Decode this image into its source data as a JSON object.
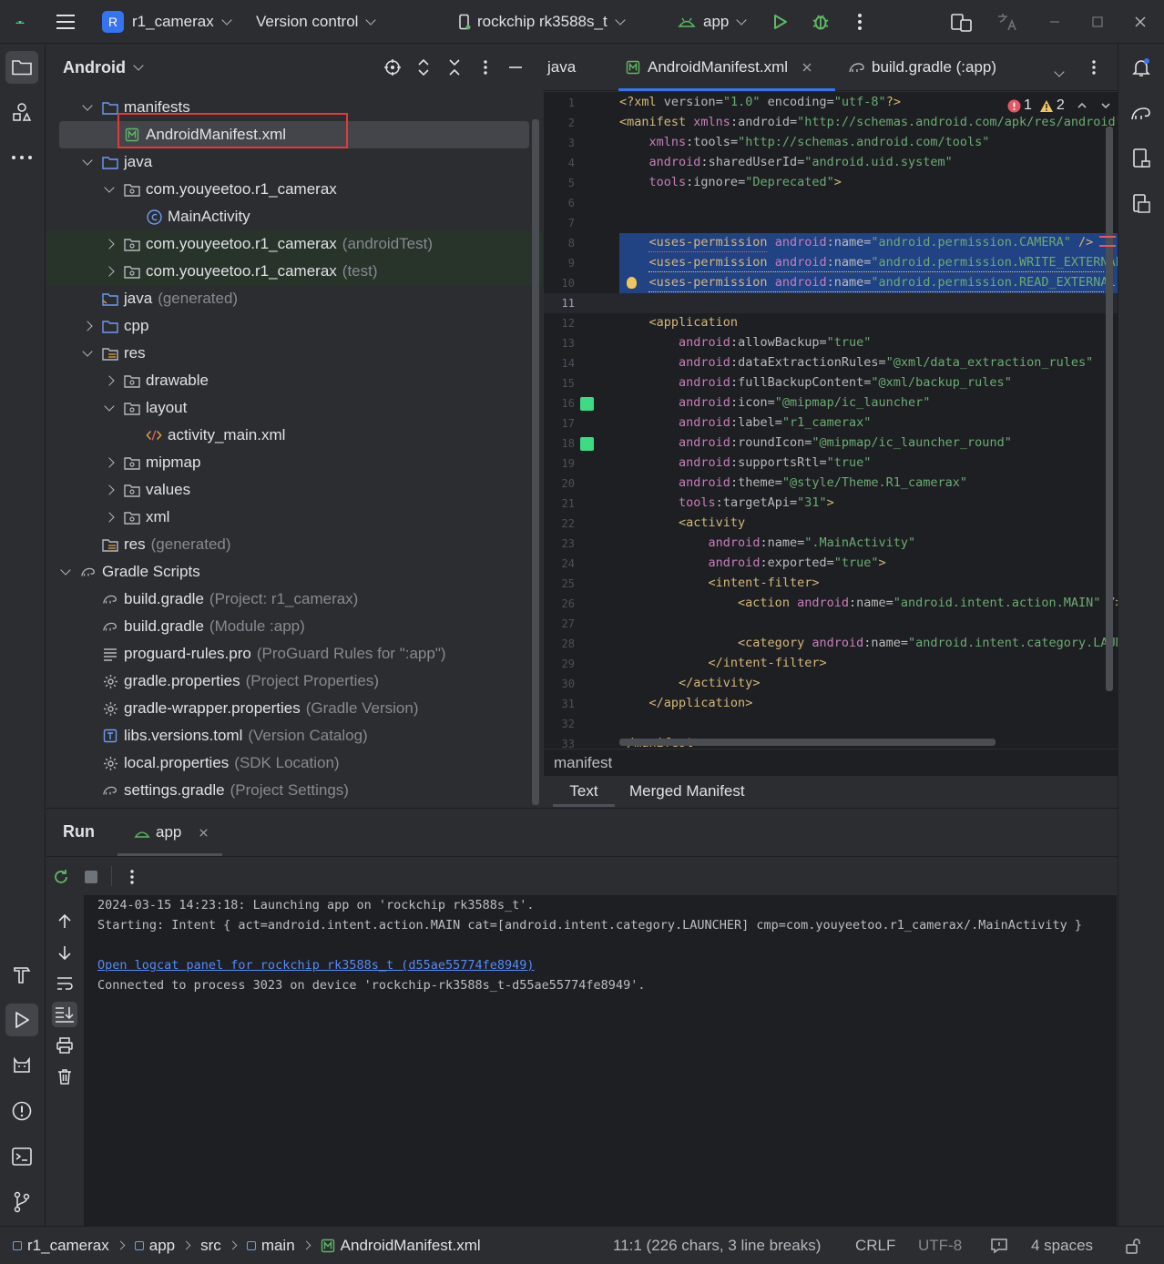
{
  "titlebar": {
    "project_badge": "R",
    "project_name": "r1_camerax",
    "vcs": "Version control",
    "device": "rockchip rk3588s_t",
    "run_config": "app"
  },
  "project_panel": {
    "view_name": "Android",
    "tree": [
      {
        "label": "manifests",
        "suffix": "",
        "depth": 2,
        "arrow": "down",
        "icon": "folder"
      },
      {
        "label": "AndroidManifest.xml",
        "suffix": "",
        "depth": 3,
        "arrow": "",
        "icon": "manifest",
        "selected": true
      },
      {
        "label": "java",
        "suffix": "",
        "depth": 2,
        "arrow": "down",
        "icon": "folder"
      },
      {
        "label": "com.youyeetoo.r1_camerax",
        "suffix": "",
        "depth": 3,
        "arrow": "down",
        "icon": "package"
      },
      {
        "label": "MainActivity",
        "suffix": "",
        "depth": 4,
        "arrow": "",
        "icon": "class"
      },
      {
        "label": "com.youyeetoo.r1_camerax",
        "suffix": "(androidTest)",
        "depth": 3,
        "arrow": "right",
        "icon": "package",
        "test": true
      },
      {
        "label": "com.youyeetoo.r1_camerax",
        "suffix": "(test)",
        "depth": 3,
        "arrow": "right",
        "icon": "package",
        "test": true
      },
      {
        "label": "java",
        "suffix": "(generated)",
        "depth": 2,
        "arrow": "",
        "icon": "folder-gen"
      },
      {
        "label": "cpp",
        "suffix": "",
        "depth": 2,
        "arrow": "right",
        "icon": "folder"
      },
      {
        "label": "res",
        "suffix": "",
        "depth": 2,
        "arrow": "down",
        "icon": "res"
      },
      {
        "label": "drawable",
        "suffix": "",
        "depth": 3,
        "arrow": "right",
        "icon": "package"
      },
      {
        "label": "layout",
        "suffix": "",
        "depth": 3,
        "arrow": "down",
        "icon": "package"
      },
      {
        "label": "activity_main.xml",
        "suffix": "",
        "depth": 4,
        "arrow": "",
        "icon": "xml"
      },
      {
        "label": "mipmap",
        "suffix": "",
        "depth": 3,
        "arrow": "right",
        "icon": "package"
      },
      {
        "label": "values",
        "suffix": "",
        "depth": 3,
        "arrow": "right",
        "icon": "package"
      },
      {
        "label": "xml",
        "suffix": "",
        "depth": 3,
        "arrow": "right",
        "icon": "package"
      },
      {
        "label": "res",
        "suffix": "(generated)",
        "depth": 2,
        "arrow": "",
        "icon": "res"
      },
      {
        "label": "Gradle Scripts",
        "suffix": "",
        "depth": 1,
        "arrow": "down",
        "icon": "gradle"
      },
      {
        "label": "build.gradle",
        "suffix": "(Project: r1_camerax)",
        "depth": 2,
        "arrow": "",
        "icon": "gradle"
      },
      {
        "label": "build.gradle",
        "suffix": "(Module :app)",
        "depth": 2,
        "arrow": "",
        "icon": "gradle"
      },
      {
        "label": "proguard-rules.pro",
        "suffix": "(ProGuard Rules for \":app\")",
        "depth": 2,
        "arrow": "",
        "icon": "lines"
      },
      {
        "label": "gradle.properties",
        "suffix": "(Project Properties)",
        "depth": 2,
        "arrow": "",
        "icon": "gear"
      },
      {
        "label": "gradle-wrapper.properties",
        "suffix": "(Gradle Version)",
        "depth": 2,
        "arrow": "",
        "icon": "gear"
      },
      {
        "label": "libs.versions.toml",
        "suffix": "(Version Catalog)",
        "depth": 2,
        "arrow": "",
        "icon": "toml"
      },
      {
        "label": "local.properties",
        "suffix": "(SDK Location)",
        "depth": 2,
        "arrow": "",
        "icon": "gear"
      },
      {
        "label": "settings.gradle",
        "suffix": "(Project Settings)",
        "depth": 2,
        "arrow": "",
        "icon": "gradle"
      }
    ]
  },
  "editor": {
    "tabs": [
      {
        "label": "java",
        "active": false,
        "closable": false
      },
      {
        "label": "AndroidManifest.xml",
        "active": true,
        "closable": true
      },
      {
        "label": "build.gradle (:app)",
        "active": false,
        "closable": false
      }
    ],
    "inspections": {
      "errors": "1",
      "warnings": "2"
    },
    "current_line": 11,
    "lines": [
      "<?xml version=\"1.0\" encoding=\"utf-8\"?>",
      "<manifest xmlns:android=\"http://schemas.android.com/apk/res/android\"",
      "    xmlns:tools=\"http://schemas.android.com/tools\"",
      "    android:sharedUserId=\"android.uid.system\"",
      "    tools:ignore=\"Deprecated\">",
      "",
      "",
      "    <uses-permission android:name=\"android.permission.CAMERA\" />",
      "    <uses-permission android:name=\"android.permission.WRITE_EXTERNAL",
      "    <uses-permission android:name=\"android.permission.READ_EXTERNAL",
      "",
      "    <application",
      "        android:allowBackup=\"true\"",
      "        android:dataExtractionRules=\"@xml/data_extraction_rules\"",
      "        android:fullBackupContent=\"@xml/backup_rules\"",
      "        android:icon=\"@mipmap/ic_launcher\"",
      "        android:label=\"r1_camerax\"",
      "        android:roundIcon=\"@mipmap/ic_launcher_round\"",
      "        android:supportsRtl=\"true\"",
      "        android:theme=\"@style/Theme.R1_camerax\"",
      "        tools:targetApi=\"31\">",
      "        <activity",
      "            android:name=\".MainActivity\"",
      "            android:exported=\"true\">",
      "            <intent-filter>",
      "                <action android:name=\"android.intent.action.MAIN\" />",
      "",
      "                <category android:name=\"android.intent.category.LAUN",
      "            </intent-filter>",
      "        </activity>",
      "    </application>",
      "",
      "</manifest>"
    ],
    "breadcrumb": "manifest",
    "bottom_tabs": [
      "Text",
      "Merged Manifest"
    ]
  },
  "run_panel": {
    "title": "Run",
    "tab": "app",
    "console": [
      {
        "text": "2024-03-15 14:23:18: Launching app on 'rockchip rk3588s_t'.",
        "link": false
      },
      {
        "text": "Starting: Intent { act=android.intent.action.MAIN cat=[android.intent.category.LAUNCHER] cmp=com.youyeetoo.r1_camerax/.MainActivity }",
        "link": false
      },
      {
        "text": "",
        "link": false
      },
      {
        "text": "Open logcat panel for rockchip rk3588s_t (d55ae55774fe8949)",
        "link": true
      },
      {
        "text": "Connected to process 3023 on device 'rockchip-rk3588s_t-d55ae55774fe8949'.",
        "link": false
      }
    ]
  },
  "statusbar": {
    "path": [
      "r1_camerax",
      "app",
      "src",
      "main",
      "AndroidManifest.xml"
    ],
    "position": "11:1 (226 chars, 3 line breaks)",
    "line_sep": "CRLF",
    "encoding": "UTF-8",
    "indent": "4 spaces"
  },
  "colors": {
    "accent": "#3574f0",
    "selection": "#43454a",
    "highlight": "#214283",
    "annotation_red": "#e5383b",
    "test_bg": "#28332a"
  }
}
